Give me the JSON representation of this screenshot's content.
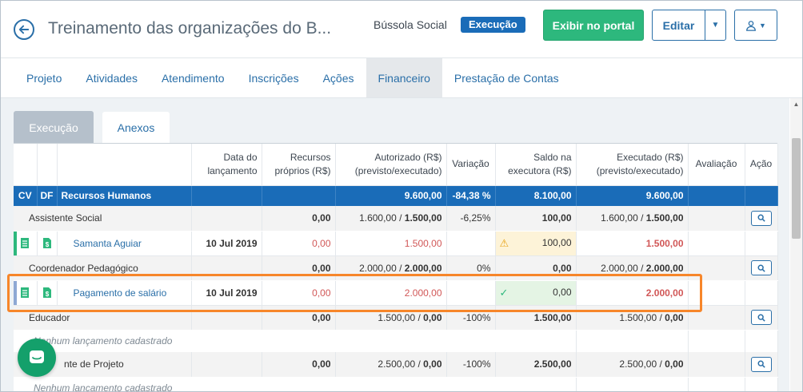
{
  "header": {
    "title": "Treinamento das organizações do B...",
    "org_name": "Bússola Social",
    "status_badge": "Execução",
    "portal_button": "Exibir no portal",
    "edit_button": "Editar"
  },
  "nav": {
    "tabs": [
      {
        "label": "Projeto"
      },
      {
        "label": "Atividades"
      },
      {
        "label": "Atendimento"
      },
      {
        "label": "Inscrições"
      },
      {
        "label": "Ações"
      },
      {
        "label": "Financeiro",
        "active": true
      },
      {
        "label": "Prestação de Contas"
      }
    ]
  },
  "subtabs": {
    "execucao": "Execução",
    "anexos": "Anexos"
  },
  "table": {
    "headers": {
      "data_lancamento": "Data do lançamento",
      "recursos_proprios": "Recursos próprios (R$)",
      "autorizado": "Autorizado (R$) (previsto/executado)",
      "variacao": "Variação",
      "saldo": "Saldo na executora (R$)",
      "executado": "Executado (R$) (previsto/executado)",
      "avaliacao": "Avaliação",
      "acao": "Ação"
    },
    "group": {
      "cv": "CV",
      "df": "DF",
      "name": "Recursos Humanos",
      "autorizado": "9.600,00",
      "variacao": "-84,38 %",
      "saldo": "8.100,00",
      "executado": "9.600,00"
    },
    "rows": {
      "assistente": {
        "name": "Assistente Social",
        "recursos": "0,00",
        "aut_prev": "1.600,00 / ",
        "aut_exec": "1.500,00",
        "variacao": "-6,25%",
        "saldo": "100,00",
        "exe_prev": "1.600,00 / ",
        "exe_exec": "1.500,00"
      },
      "samanta": {
        "name": "Samanta Aguiar",
        "date": "10 Jul 2019",
        "recursos": "0,00",
        "autorizado": "1.500,00",
        "saldo": "100,00",
        "executado": "1.500,00"
      },
      "coordenador": {
        "name": "Coordenador Pedagógico",
        "recursos": "0,00",
        "aut_prev": "2.000,00 / ",
        "aut_exec": "2.000,00",
        "variacao": "0%",
        "saldo": "0,00",
        "exe_prev": "2.000,00 / ",
        "exe_exec": "2.000,00"
      },
      "pagamento": {
        "name": "Pagamento de salário",
        "date": "10 Jul 2019",
        "recursos": "0,00",
        "autorizado": "2.000,00",
        "saldo": "0,00",
        "executado": "2.000,00"
      },
      "educador": {
        "name": "Educador",
        "recursos": "0,00",
        "aut_prev": "1.500,00 / ",
        "aut_exec": "0,00",
        "variacao": "-100%",
        "saldo": "1.500,00",
        "exe_prev": "1.500,00 / ",
        "exe_exec": "0,00"
      },
      "empty1": "Nenhum lançamento cadastrado",
      "agente": {
        "name": "nte de Projeto",
        "recursos": "0,00",
        "aut_prev": "2.500,00 / ",
        "aut_exec": "0,00",
        "variacao": "-100%",
        "saldo": "2.500,00",
        "exe_prev": "2.500,00 / ",
        "exe_exec": "0,00"
      },
      "empty2": "Nenhum lançamento cadastrado"
    }
  }
}
